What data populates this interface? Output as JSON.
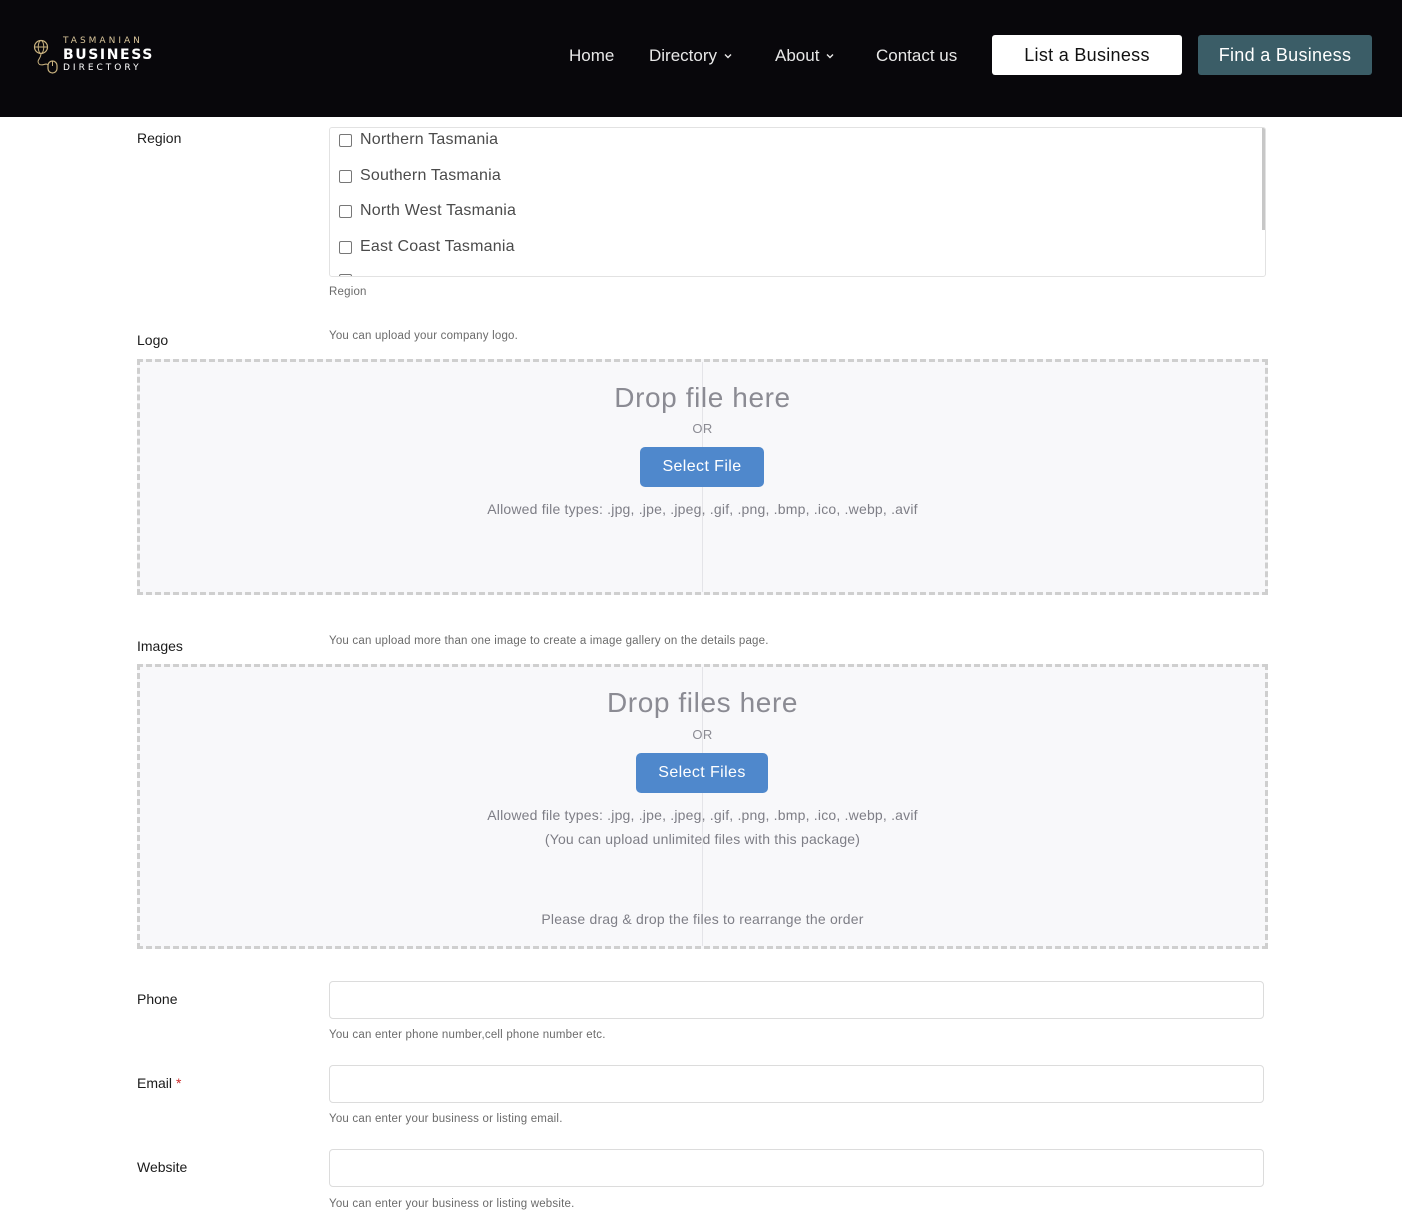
{
  "header": {
    "logo": {
      "line1": "TASMANIAN",
      "line2": "BUSINESS",
      "line3": "DIRECTORY"
    },
    "nav": [
      {
        "label": "Home"
      },
      {
        "label": "Directory"
      },
      {
        "label": "About"
      },
      {
        "label": "Contact us"
      }
    ],
    "list_button": "List a Business",
    "find_button": "Find a Business"
  },
  "region": {
    "label": "Region",
    "options": [
      "Northern Tasmania",
      "Southern Tasmania",
      "North West Tasmania",
      "East Coast Tasmania"
    ],
    "help": "Region"
  },
  "logo_field": {
    "label": "Logo",
    "help": "You can upload your company logo.",
    "drop_title": "Drop file here",
    "or": "OR",
    "button": "Select File",
    "allowed": "Allowed file types: .jpg, .jpe, .jpeg, .gif, .png, .bmp, .ico, .webp, .avif"
  },
  "images_field": {
    "label": "Images",
    "help": "You can upload more than one image to create a image gallery on the details page.",
    "drop_title": "Drop files here",
    "or": "OR",
    "button": "Select Files",
    "allowed": "Allowed file types: .jpg, .jpe, .jpeg, .gif, .png, .bmp, .ico, .webp, .avif",
    "unlimited": "(You can upload unlimited files with this package)",
    "rearrange": "Please drag & drop the files to rearrange the order"
  },
  "phone": {
    "label": "Phone",
    "value": "",
    "help": "You can enter phone number,cell phone number etc."
  },
  "email": {
    "label": "Email",
    "required": "*",
    "value": "",
    "help": "You can enter your business or listing email."
  },
  "website": {
    "label": "Website",
    "value": "",
    "help": "You can enter your business or listing website."
  },
  "colors": {
    "header_bg": "#08070b",
    "find_button": "#3b5d67",
    "select_button": "#4f88cc",
    "required": "#cc2b2b"
  }
}
